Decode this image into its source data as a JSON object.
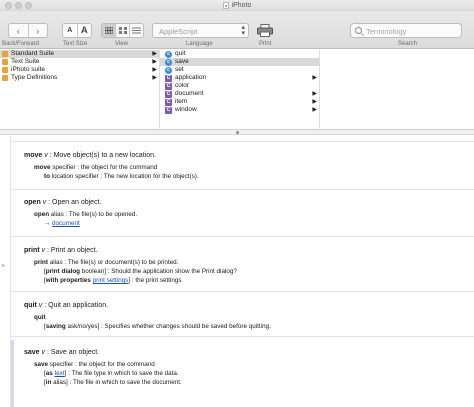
{
  "window": {
    "title": "iPhoto"
  },
  "toolbar": {
    "back_label": "Back/Forward",
    "textsize_label": "Text Size",
    "textsize_small": "A",
    "textsize_large": "A",
    "view_label": "View",
    "language_label": "Language",
    "language_value": "AppleScript",
    "print_label": "Print",
    "search_label": "Search",
    "search_placeholder": "Terminology"
  },
  "browser": {
    "suites": [
      "Standard Suite",
      "Text Suite",
      "iPhoto suite",
      "Type Definitions"
    ],
    "selected_suite": 0,
    "items": [
      {
        "kind": "command",
        "badge": "c",
        "label": "quit",
        "has_children": false
      },
      {
        "kind": "command",
        "badge": "c",
        "label": "save",
        "has_children": false,
        "selected": true
      },
      {
        "kind": "command",
        "badge": "c",
        "label": "set",
        "has_children": false
      },
      {
        "kind": "class",
        "badge": "C",
        "label": "application",
        "has_children": true
      },
      {
        "kind": "class",
        "badge": "C",
        "label": "color",
        "has_children": false
      },
      {
        "kind": "class",
        "badge": "C",
        "label": "document",
        "has_children": true
      },
      {
        "kind": "class",
        "badge": "C",
        "label": "item",
        "has_children": true
      },
      {
        "kind": "class",
        "badge": "C",
        "label": "window",
        "has_children": true
      }
    ]
  },
  "dictionary": {
    "move": {
      "name": "move",
      "type": "v",
      "desc": ": Move object(s) to a new location.",
      "p1_name": "move",
      "p1_rest": " specifier : the object for the command",
      "p2_name": "to",
      "p2_rest": " location specifier : The new location for the object(s)."
    },
    "open": {
      "name": "open",
      "type": "v",
      "desc": ": Open an object.",
      "p1_name": "open",
      "p1_rest": " alias : The file(s) to be opened.",
      "p2_arrow": "→ ",
      "p2_link": "document"
    },
    "print": {
      "name": "print",
      "type": "v",
      "desc": ": Print an object.",
      "p1_name": "print",
      "p1_rest": " alias : The file(s) or document(s) to be printed.",
      "p2_open": "[",
      "p2_name": "print dialog",
      "p2_rest": " boolean] : Should the application show the Print dialog?",
      "p3_open": "[",
      "p3_name": "with properties",
      "p3_sp": " ",
      "p3_link": "print settings",
      "p3_rest": "] : the print settings"
    },
    "quit": {
      "name": "quit",
      "type": "v",
      "desc": ": Quit an application.",
      "p1_name": "quit",
      "p2_open": "[",
      "p2_name": "saving",
      "p2_rest": " ask/no/yes] : Specifies whether changes should be saved before quitting."
    },
    "save": {
      "name": "save",
      "type": "v",
      "desc": ": Save an object.",
      "p1_name": "save",
      "p1_rest": " specifier : the object for the command",
      "p2_open": "[",
      "p2_name": "as",
      "p2_sp": " ",
      "p2_link": "text",
      "p2_rest": "] : The file type in which to save the data.",
      "p3_open": "[",
      "p3_name": "in",
      "p3_rest": " alias] : The file in which to save the document."
    }
  }
}
